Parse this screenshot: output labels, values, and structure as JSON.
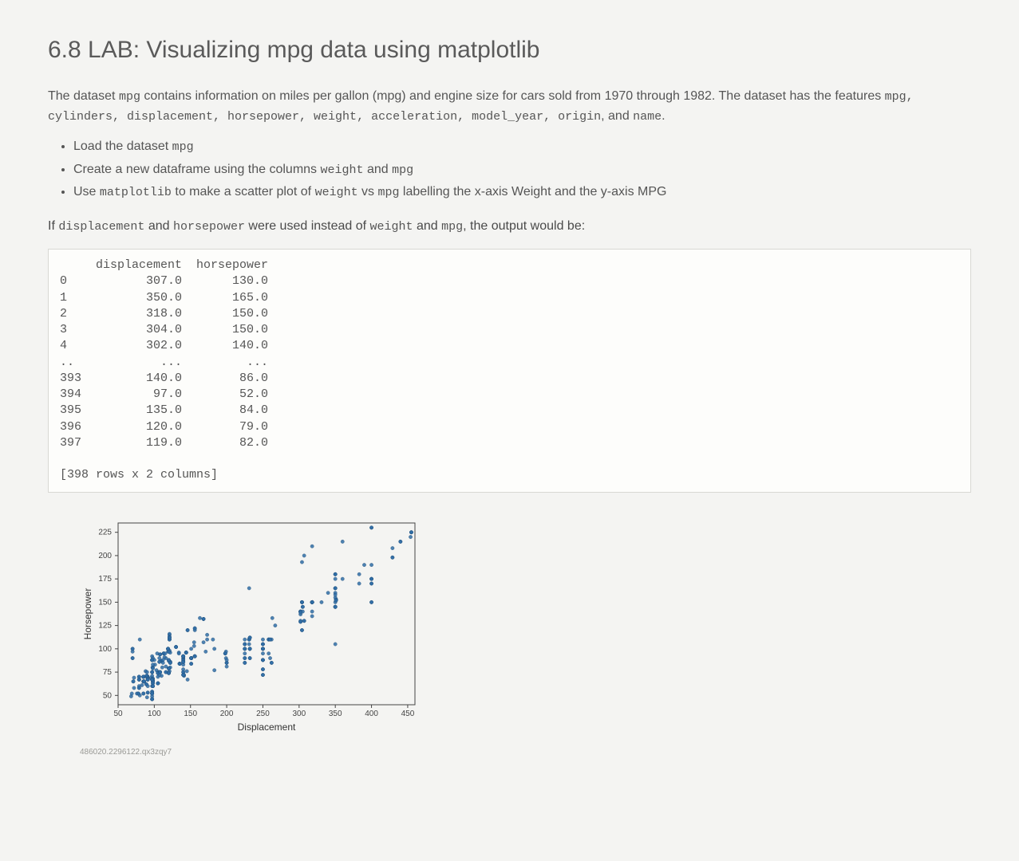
{
  "title": "6.8 LAB: Visualizing mpg data using matplotlib",
  "intro": {
    "p1_a": "The dataset ",
    "p1_code": "mpg",
    "p1_b": " contains information on miles per gallon (mpg) and engine size for cars sold from 1970 through 1982. The dataset has the features ",
    "features_list": "mpg, cylinders, displacement, horsepower, weight, acceleration, model_year, origin",
    "p1_c": ", and ",
    "name_code": "name",
    "period": "."
  },
  "bullets": {
    "b1_a": "Load the dataset ",
    "b1_code": "mpg",
    "b2_a": "Create a new dataframe using the columns ",
    "b2_code1": "weight",
    "b2_and": " and ",
    "b2_code2": "mpg",
    "b3_a": "Use ",
    "b3_code1": "matplotlib",
    "b3_b": " to make a scatter plot of ",
    "b3_code2": "weight",
    "b3_vs": " vs ",
    "b3_code3": "mpg",
    "b3_c": " labelling the x-axis ",
    "b3_xl": "Weight",
    "b3_d": " and the y-axis ",
    "b3_yl": "MPG"
  },
  "if_sentence": {
    "a": "If ",
    "c1": "displacement",
    "b": " and ",
    "c2": "horsepower",
    "c": " were used instead of ",
    "c3": "weight",
    "d": " and ",
    "c4": "mpg",
    "e": ", the output would be:"
  },
  "console": {
    "header": "     displacement  horsepower",
    "rows": [
      "0           307.0       130.0",
      "1           350.0       165.0",
      "2           318.0       150.0",
      "3           304.0       150.0",
      "4           302.0       140.0",
      "..            ...         ...",
      "393         140.0        86.0",
      "394          97.0        52.0",
      "395         135.0        84.0",
      "396         120.0        79.0",
      "397         119.0        82.0"
    ],
    "footer": "[398 rows x 2 columns]"
  },
  "chart_data": {
    "type": "scatter",
    "xlabel": "Displacement",
    "ylabel": "Horsepower",
    "xlim": [
      50,
      460
    ],
    "ylim": [
      40,
      235
    ],
    "xticks": [
      50,
      100,
      150,
      200,
      250,
      300,
      350,
      400,
      450
    ],
    "yticks": [
      50,
      75,
      100,
      125,
      150,
      175,
      200,
      225
    ],
    "points": [
      [
        307,
        130
      ],
      [
        350,
        165
      ],
      [
        318,
        150
      ],
      [
        304,
        150
      ],
      [
        302,
        140
      ],
      [
        429,
        198
      ],
      [
        454,
        220
      ],
      [
        440,
        215
      ],
      [
        455,
        225
      ],
      [
        390,
        190
      ],
      [
        383,
        170
      ],
      [
        340,
        160
      ],
      [
        400,
        150
      ],
      [
        455,
        225
      ],
      [
        113,
        95
      ],
      [
        198,
        95
      ],
      [
        199,
        97
      ],
      [
        200,
        85
      ],
      [
        97,
        88
      ],
      [
        97,
        46
      ],
      [
        110,
        87
      ],
      [
        107,
        90
      ],
      [
        104,
        95
      ],
      [
        121,
        113
      ],
      [
        199,
        90
      ],
      [
        360,
        215
      ],
      [
        307,
        200
      ],
      [
        318,
        210
      ],
      [
        304,
        193
      ],
      [
        97,
        88
      ],
      [
        140,
        90
      ],
      [
        113,
        95
      ],
      [
        98,
        63
      ],
      [
        232,
        100
      ],
      [
        225,
        105
      ],
      [
        250,
        100
      ],
      [
        250,
        88
      ],
      [
        232,
        100
      ],
      [
        350,
        165
      ],
      [
        400,
        175
      ],
      [
        351,
        153
      ],
      [
        318,
        150
      ],
      [
        383,
        180
      ],
      [
        400,
        170
      ],
      [
        400,
        175
      ],
      [
        258,
        110
      ],
      [
        140,
        72
      ],
      [
        250,
        100
      ],
      [
        250,
        88
      ],
      [
        122,
        85
      ],
      [
        116,
        90
      ],
      [
        79,
        70
      ],
      [
        88,
        76
      ],
      [
        71,
        65
      ],
      [
        72,
        69
      ],
      [
        97,
        60
      ],
      [
        91,
        70
      ],
      [
        113,
        95
      ],
      [
        97.5,
        80
      ],
      [
        97,
        54
      ],
      [
        140,
        90
      ],
      [
        122,
        86
      ],
      [
        350,
        165
      ],
      [
        400,
        175
      ],
      [
        318,
        150
      ],
      [
        351,
        153
      ],
      [
        304,
        150
      ],
      [
        429,
        208
      ],
      [
        350,
        155
      ],
      [
        350,
        160
      ],
      [
        400,
        190
      ],
      [
        70,
        97
      ],
      [
        304,
        120
      ],
      [
        307,
        130
      ],
      [
        302,
        140
      ],
      [
        318,
        150
      ],
      [
        121,
        112
      ],
      [
        121,
        76
      ],
      [
        120,
        87
      ],
      [
        96,
        69
      ],
      [
        122,
        86
      ],
      [
        97,
        92
      ],
      [
        120,
        97
      ],
      [
        98,
        80
      ],
      [
        97,
        88
      ],
      [
        350,
        175
      ],
      [
        304,
        150
      ],
      [
        350,
        145
      ],
      [
        302,
        137
      ],
      [
        318,
        150
      ],
      [
        429,
        198
      ],
      [
        400,
        150
      ],
      [
        350,
        158
      ],
      [
        318,
        150
      ],
      [
        440,
        215
      ],
      [
        455,
        225
      ],
      [
        360,
        175
      ],
      [
        225,
        105
      ],
      [
        250,
        100
      ],
      [
        232,
        100
      ],
      [
        250,
        88
      ],
      [
        198,
        95
      ],
      [
        97,
        46
      ],
      [
        400,
        230
      ],
      [
        97,
        49
      ],
      [
        140,
        75
      ],
      [
        108,
        94
      ],
      [
        70,
        90
      ],
      [
        122,
        85
      ],
      [
        155,
        107
      ],
      [
        98,
        90
      ],
      [
        350,
        145
      ],
      [
        400,
        230
      ],
      [
        68,
        49
      ],
      [
        116,
        75
      ],
      [
        114,
        91
      ],
      [
        121,
        112
      ],
      [
        318,
        150
      ],
      [
        121,
        110
      ],
      [
        156,
        122
      ],
      [
        350,
        180
      ],
      [
        198,
        95
      ],
      [
        232,
        100
      ],
      [
        250,
        100
      ],
      [
        79,
        67
      ],
      [
        122,
        80
      ],
      [
        71,
        65
      ],
      [
        140,
        75
      ],
      [
        250,
        100
      ],
      [
        258,
        110
      ],
      [
        225,
        105
      ],
      [
        302,
        140
      ],
      [
        350,
        150
      ],
      [
        318,
        150
      ],
      [
        302,
        140
      ],
      [
        304,
        150
      ],
      [
        98,
        66
      ],
      [
        79,
        70
      ],
      [
        97,
        75
      ],
      [
        76,
        52
      ],
      [
        83,
        61
      ],
      [
        90,
        75
      ],
      [
        90,
        71
      ],
      [
        116,
        75
      ],
      [
        120,
        74
      ],
      [
        108,
        94
      ],
      [
        79,
        67
      ],
      [
        225,
        100
      ],
      [
        250,
        105
      ],
      [
        250,
        72
      ],
      [
        250,
        72
      ],
      [
        400,
        170
      ],
      [
        350,
        145
      ],
      [
        318,
        150
      ],
      [
        351,
        152
      ],
      [
        231,
        110
      ],
      [
        250,
        105
      ],
      [
        258,
        110
      ],
      [
        225,
        95
      ],
      [
        231,
        110
      ],
      [
        262,
        110
      ],
      [
        302,
        129
      ],
      [
        97,
        75
      ],
      [
        140,
        83
      ],
      [
        232,
        100
      ],
      [
        140,
        78
      ],
      [
        134,
        96
      ],
      [
        90,
        71
      ],
      [
        119,
        97
      ],
      [
        171,
        97
      ],
      [
        90,
        70
      ],
      [
        232,
        90
      ],
      [
        115,
        95
      ],
      [
        120,
        88
      ],
      [
        121,
        98
      ],
      [
        121,
        115
      ],
      [
        91,
        53
      ],
      [
        107,
        86
      ],
      [
        116,
        81
      ],
      [
        140,
        92
      ],
      [
        98,
        79
      ],
      [
        101,
        83
      ],
      [
        305,
        140
      ],
      [
        318,
        150
      ],
      [
        304,
        120
      ],
      [
        351,
        152
      ],
      [
        225,
        100
      ],
      [
        250,
        105
      ],
      [
        200,
        81
      ],
      [
        232,
        90
      ],
      [
        85,
        52
      ],
      [
        98,
        60
      ],
      [
        90,
        70
      ],
      [
        91,
        53
      ],
      [
        225,
        100
      ],
      [
        250,
        78
      ],
      [
        250,
        110
      ],
      [
        258,
        95
      ],
      [
        97,
        71
      ],
      [
        85,
        70
      ],
      [
        97,
        75
      ],
      [
        140,
        72
      ],
      [
        130,
        102
      ],
      [
        318,
        150
      ],
      [
        120,
        74
      ],
      [
        156,
        120
      ],
      [
        168,
        132
      ],
      [
        350,
        180
      ],
      [
        350,
        145
      ],
      [
        302,
        130
      ],
      [
        318,
        150
      ],
      [
        98,
        68
      ],
      [
        111,
        80
      ],
      [
        79,
        58
      ],
      [
        122,
        96
      ],
      [
        85,
        70
      ],
      [
        305,
        145
      ],
      [
        260,
        110
      ],
      [
        318,
        140
      ],
      [
        302,
        139
      ],
      [
        250,
        95
      ],
      [
        231,
        105
      ],
      [
        225,
        85
      ],
      [
        250,
        88
      ],
      [
        97,
        67
      ],
      [
        98,
        60
      ],
      [
        121,
        110
      ],
      [
        183,
        100
      ],
      [
        350,
        180
      ],
      [
        141,
        71
      ],
      [
        260,
        110
      ],
      [
        105,
        63
      ],
      [
        105,
        74
      ],
      [
        85,
        52
      ],
      [
        91,
        68
      ],
      [
        151,
        90
      ],
      [
        163,
        133
      ],
      [
        98,
        83
      ],
      [
        86,
        65
      ],
      [
        98,
        65
      ],
      [
        79,
        60
      ],
      [
        97,
        67
      ],
      [
        331,
        150
      ],
      [
        121,
        110
      ],
      [
        156,
        92
      ],
      [
        350,
        145
      ],
      [
        78,
        52
      ],
      [
        134,
        95
      ],
      [
        200,
        85
      ],
      [
        119,
        100
      ],
      [
        141,
        72
      ],
      [
        135,
        84
      ],
      [
        151,
        90
      ],
      [
        151,
        90
      ],
      [
        105,
        75
      ],
      [
        91,
        69
      ],
      [
        151,
        90
      ],
      [
        130,
        102
      ],
      [
        69,
        52
      ],
      [
        232,
        112
      ],
      [
        225,
        90
      ],
      [
        250,
        78
      ],
      [
        225,
        90
      ],
      [
        110,
        87
      ],
      [
        98,
        60
      ],
      [
        146,
        120
      ],
      [
        151,
        90
      ],
      [
        78,
        52
      ],
      [
        80,
        50
      ],
      [
        122,
        85
      ],
      [
        267,
        125
      ],
      [
        168,
        132
      ],
      [
        146,
        67
      ],
      [
        72,
        58
      ],
      [
        151,
        100
      ],
      [
        85,
        70
      ],
      [
        98,
        65
      ],
      [
        89,
        71
      ],
      [
        98,
        68
      ],
      [
        231,
        110
      ],
      [
        200,
        85
      ],
      [
        140,
        88
      ],
      [
        90,
        48
      ],
      [
        98,
        66
      ],
      [
        78,
        52
      ],
      [
        85,
        70
      ],
      [
        91,
        68
      ],
      [
        225,
        85
      ],
      [
        89,
        62
      ],
      [
        168,
        107
      ],
      [
        70,
        100
      ],
      [
        120,
        79
      ],
      [
        156,
        92
      ],
      [
        151,
        84
      ],
      [
        140,
        92
      ],
      [
        151,
        90
      ],
      [
        79,
        58
      ],
      [
        225,
        110
      ],
      [
        85,
        65
      ],
      [
        112,
        88
      ],
      [
        112,
        85
      ],
      [
        151,
        90
      ],
      [
        120,
        74
      ],
      [
        121,
        116
      ],
      [
        145,
        76
      ],
      [
        168,
        132
      ],
      [
        350,
        105
      ],
      [
        183,
        77
      ],
      [
        260,
        90
      ],
      [
        231,
        165
      ],
      [
        146,
        120
      ],
      [
        135,
        84
      ],
      [
        98,
        63
      ],
      [
        105,
        74
      ],
      [
        100,
        88
      ],
      [
        108,
        75
      ],
      [
        91,
        60
      ],
      [
        91,
        67
      ],
      [
        105,
        63
      ],
      [
        263,
        133
      ],
      [
        98,
        65
      ],
      [
        231,
        110
      ],
      [
        140,
        72
      ],
      [
        232,
        112
      ],
      [
        144,
        96
      ],
      [
        135,
        84
      ],
      [
        155,
        103
      ],
      [
        181,
        110
      ],
      [
        262,
        85
      ],
      [
        140,
        86
      ],
      [
        97,
        52
      ],
      [
        70,
        100
      ],
      [
        79,
        70
      ],
      [
        156,
        92
      ],
      [
        85,
        65
      ],
      [
        135,
        84
      ],
      [
        151,
        84
      ],
      [
        107,
        75
      ],
      [
        105,
        63
      ],
      [
        85,
        65
      ],
      [
        119,
        100
      ],
      [
        120,
        74
      ],
      [
        80,
        110
      ],
      [
        105,
        70
      ],
      [
        91,
        68
      ],
      [
        110,
        71
      ],
      [
        79,
        67
      ],
      [
        120,
        97
      ],
      [
        91,
        67
      ],
      [
        98,
        60
      ],
      [
        120,
        88
      ],
      [
        108,
        94
      ],
      [
        140,
        88
      ],
      [
        85,
        70
      ],
      [
        107,
        72
      ],
      [
        103,
        77
      ],
      [
        105,
        74
      ],
      [
        97,
        88
      ],
      [
        91,
        67
      ],
      [
        89,
        62
      ],
      [
        151,
        90
      ],
      [
        173,
        110
      ],
      [
        173,
        115
      ],
      [
        151,
        90
      ],
      [
        97,
        46
      ],
      [
        105,
        74
      ],
      [
        200,
        88
      ],
      [
        225,
        100
      ],
      [
        305,
        145
      ],
      [
        302,
        129
      ],
      [
        318,
        135
      ],
      [
        107,
        86
      ],
      [
        151,
        90
      ],
      [
        140,
        92
      ],
      [
        144,
        96
      ],
      [
        135,
        84
      ],
      [
        120,
        79
      ],
      [
        119,
        100
      ],
      [
        108,
        75
      ],
      [
        86,
        65
      ],
      [
        156,
        92
      ],
      [
        97,
        52
      ],
      [
        144,
        96
      ],
      [
        140,
        92
      ],
      [
        105,
        63
      ],
      [
        85,
        65
      ],
      [
        97,
        67
      ],
      [
        140,
        86
      ],
      [
        97,
        54
      ],
      [
        151,
        90
      ],
      [
        262,
        85
      ],
      [
        156,
        122
      ],
      [
        232,
        112
      ],
      [
        144,
        96
      ],
      [
        135,
        84
      ],
      [
        140,
        92
      ],
      [
        85,
        70
      ],
      [
        70,
        90
      ],
      [
        130,
        102
      ],
      [
        121,
        112
      ],
      [
        140,
        86
      ],
      [
        97,
        52
      ],
      [
        135,
        84
      ],
      [
        120,
        79
      ],
      [
        119,
        100
      ],
      [
        108,
        75
      ],
      [
        86,
        65
      ],
      [
        156,
        92
      ],
      [
        85,
        70
      ],
      [
        97,
        67
      ],
      [
        140,
        86
      ],
      [
        97,
        52
      ],
      [
        135,
        84
      ],
      [
        120,
        79
      ],
      [
        119,
        100
      ],
      [
        108,
        75
      ]
    ]
  },
  "footer_id": "486020.2296122.qx3zqy7"
}
